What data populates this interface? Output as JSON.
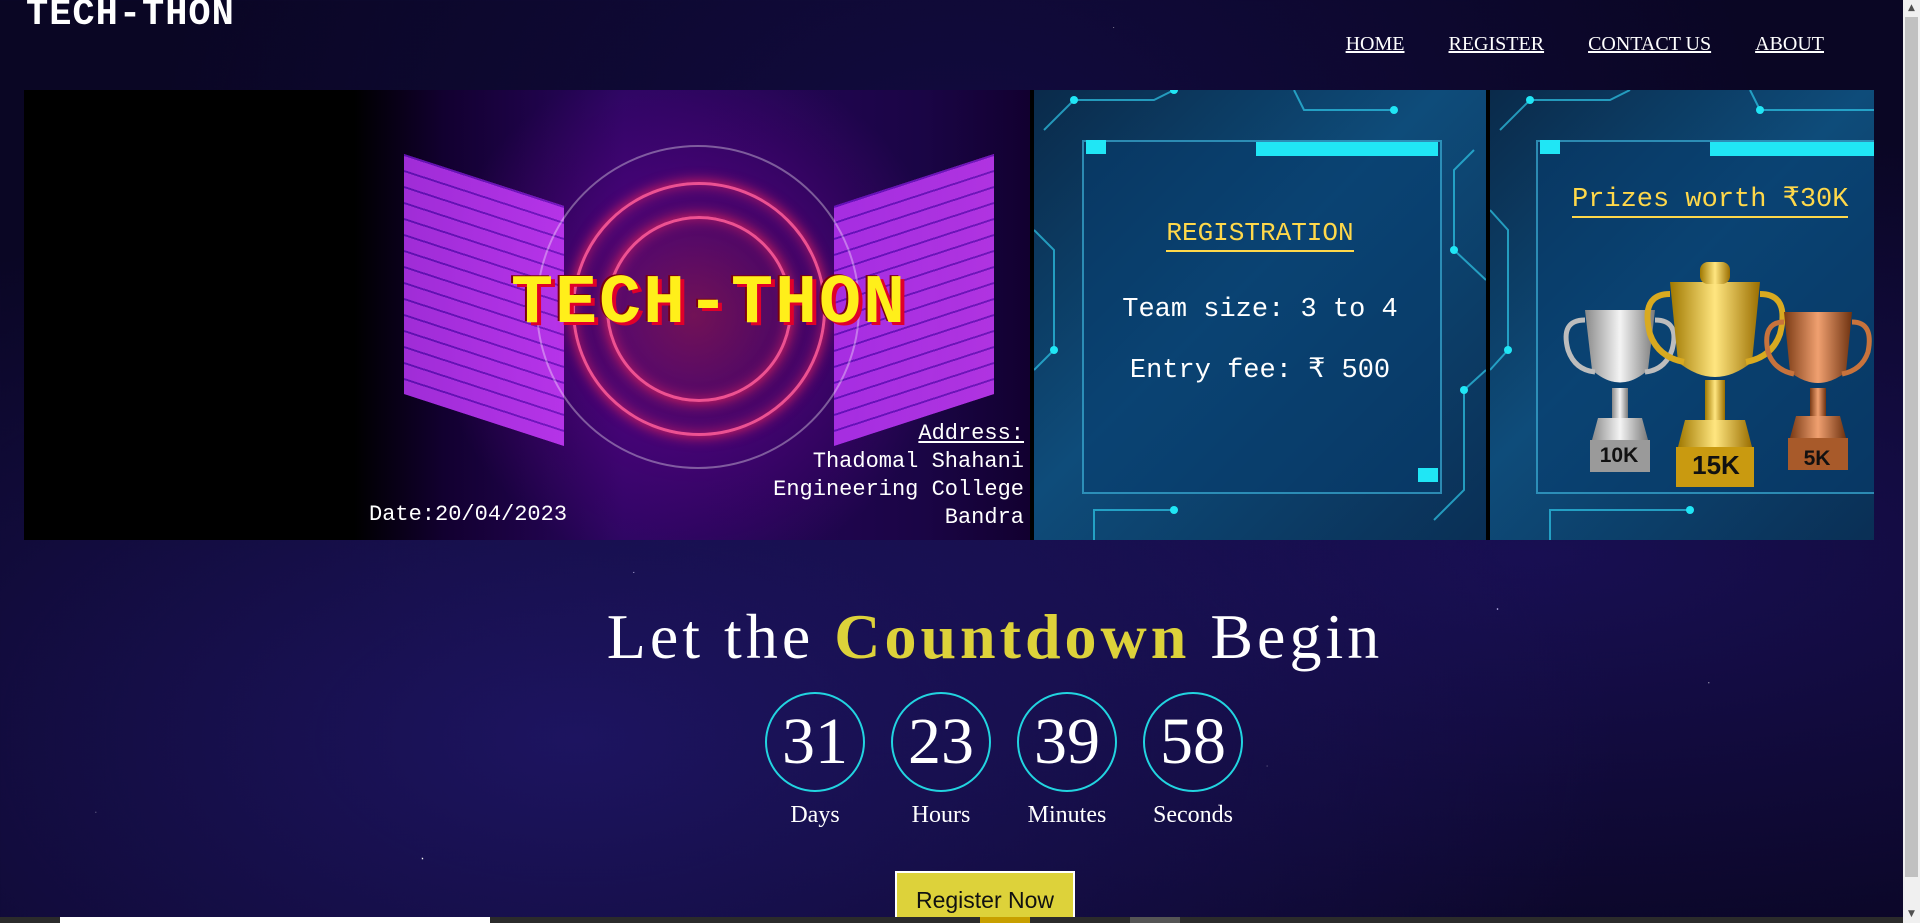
{
  "header": {
    "logo": "TECH-THON",
    "nav": [
      {
        "label": "HOME"
      },
      {
        "label": "REGISTER"
      },
      {
        "label": "CONTACT US"
      },
      {
        "label": "ABOUT"
      }
    ]
  },
  "carousel": {
    "hero": {
      "title": "TECH-THON",
      "date": "Date:20/04/2023",
      "address_title": "Address:",
      "address_lines": [
        "Thadomal Shahani",
        "Engineering College",
        "Bandra"
      ]
    },
    "registration": {
      "title": "REGISTRATION",
      "team_size": "Team size: 3 to 4",
      "entry_fee": "Entry fee: ₹ 500"
    },
    "prizes": {
      "title": "Prizes worth ₹30K",
      "trophies": [
        {
          "label": "10K",
          "color": "#c8c8c8"
        },
        {
          "label": "15K",
          "color": "#e6b800"
        },
        {
          "label": "5K",
          "color": "#c8733c"
        }
      ]
    }
  },
  "countdown": {
    "heading_before": "Let the ",
    "heading_accent": "Countdown",
    "heading_after": " Begin",
    "units": [
      {
        "value": "31",
        "label": "Days"
      },
      {
        "value": "23",
        "label": "Hours"
      },
      {
        "value": "39",
        "label": "Minutes"
      },
      {
        "value": "58",
        "label": "Seconds"
      }
    ]
  },
  "cta": {
    "label": "Register Now"
  },
  "colors": {
    "accent": "#ddd23a",
    "ring": "#22d4e0",
    "background": "#0a0624"
  }
}
